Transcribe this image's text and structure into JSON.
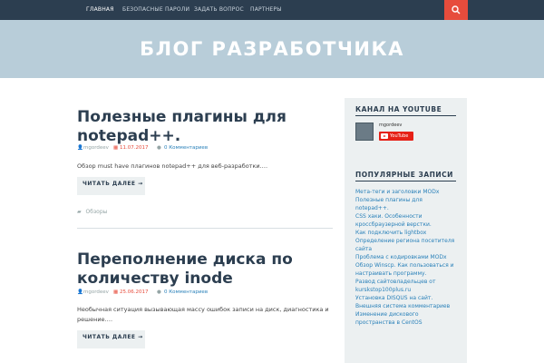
{
  "nav": {
    "items": [
      "Главная",
      "Безопасные пароли",
      "Задать вопрос",
      "Партнеры"
    ],
    "search_icon": "search-icon"
  },
  "site": {
    "title": "БЛОГ РАЗРАБОТЧИКА"
  },
  "posts": [
    {
      "title": "Полезные плагины для notepad++.",
      "author": "mgordeev",
      "date": "11.07.2017",
      "comments": "0 Комментариев",
      "excerpt": "Обзор must have плагинов notepad++ для веб-разработки.…",
      "read_more": "Читать далее →",
      "category": "Обзоры"
    },
    {
      "title": "Переполнение диска по количеству inode",
      "author": "mgordeev",
      "date": "25.06.2017",
      "comments": "0 Комментариев",
      "excerpt": "Необычная ситуация вызывающая массу ошибок записи на диск, диагностика и решение.…",
      "read_more": "Читать далее →"
    }
  ],
  "sidebar": {
    "youtube": {
      "title": "Канал на YouTube",
      "channel_name": "mgordeev",
      "button_label": "YouTube"
    },
    "popular": {
      "title": "Популярные записи",
      "items": [
        "Мета-теги и заголовки MODx",
        "Полезные плагины для notepad++.",
        "CSS хаки. Особенности кроссбраузерной верстки.",
        "Как подключить lightbox",
        "Определение региона посетителя сайта",
        "Проблема с кодировками MODx",
        "Обзор Winscp. Как пользоваться и настраивать программу.",
        "Развод сайтовладельцев от kurskstop100plus.ru",
        "Установка DISQUS на сайт. Внешняя система комментариев",
        "Изменение дискового пространства в CentOS"
      ]
    }
  }
}
